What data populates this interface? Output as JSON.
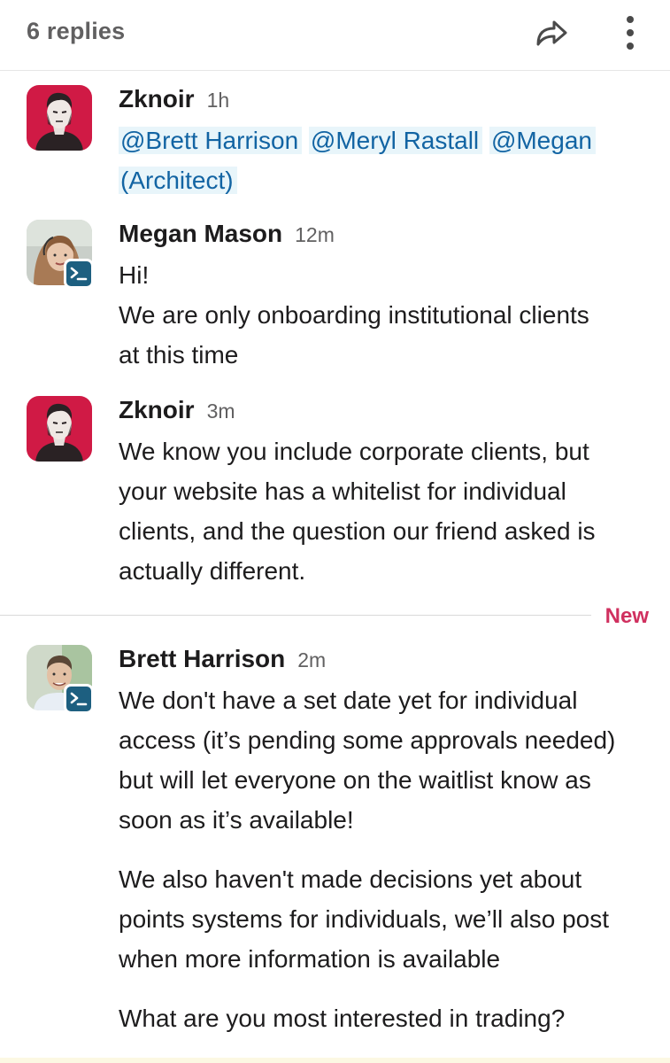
{
  "thread": {
    "title": "6 replies"
  },
  "colors": {
    "mention_bg": "#e8f5fa",
    "mention_text": "#1264a3",
    "new_label": "#d0305f",
    "app_badge": "#1d5f80"
  },
  "messages": [
    {
      "author": "Zknoir",
      "time": "1h",
      "avatar": "zknoir-avatar",
      "mentions": [
        "@Brett Harrison",
        "@Meryl Rastall",
        "@Megan",
        "(Architect)"
      ]
    },
    {
      "author": "Megan Mason",
      "time": "12m",
      "avatar": "megan-avatar",
      "badge": "terminal-app-icon",
      "lines": [
        "Hi!",
        "We are only onboarding institutional clients",
        "at this time"
      ]
    },
    {
      "author": "Zknoir",
      "time": "3m",
      "avatar": "zknoir-avatar",
      "lines": [
        "We know you include corporate clients, but",
        "your website has a whitelist for individual",
        "clients, and the question our friend asked is",
        "actually different."
      ]
    },
    {
      "author": "Brett Harrison",
      "time": "2m",
      "avatar": "brett-avatar",
      "badge": "terminal-app-icon",
      "lines": [
        "We don't have a set date yet for individual",
        "access (it’s pending some approvals needed)",
        "but will let everyone on the waitlist know as",
        "soon as it’s available!",
        "We also haven't made decisions yet about",
        "points systems for individuals, we’ll also post",
        "when more information is available",
        "What are you most interested in trading?"
      ]
    }
  ],
  "divider": {
    "label": "New"
  }
}
